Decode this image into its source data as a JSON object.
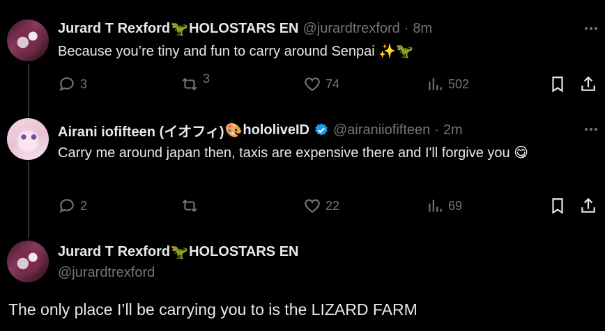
{
  "tweets": [
    {
      "name": "Jurard T Rexford",
      "name_emoji": "🦖",
      "name_suffix": "HOLOSTARS EN",
      "handle": "@jurardtrexford",
      "dot": "·",
      "time": "8m",
      "text": "Because you’re tiny and fun to carry around Senpai ✨🦖",
      "replies": "3",
      "reposts": "3",
      "likes": "74",
      "views": "502"
    },
    {
      "name": "Airani iofifteen (イオフィ)",
      "name_emoji": "🎨",
      "name_suffix": "hololiveID",
      "handle": "@airaniiofifteen",
      "dot": "·",
      "time": "2m",
      "text": "Carry me around japan then, taxis are expensive there and I'll forgive you 😋",
      "replies": "2",
      "reposts": "",
      "likes": "22",
      "views": "69"
    }
  ],
  "main_tweet": {
    "name": "Jurard T Rexford",
    "name_emoji": "🦖",
    "name_suffix": "HOLOSTARS EN",
    "handle": "@jurardtrexford",
    "text": "The only place I’ll be carrying you to is the LIZARD FARM"
  },
  "colors": {
    "background": "#000000",
    "text_primary": "#e7e9ea",
    "text_secondary": "#71767b",
    "verified_blue": "#1d9bf0",
    "thread_line": "#333639"
  },
  "icons": [
    "reply-icon",
    "repost-icon",
    "like-icon",
    "views-icon",
    "bookmark-icon",
    "share-icon",
    "more-icon",
    "verified-icon"
  ]
}
